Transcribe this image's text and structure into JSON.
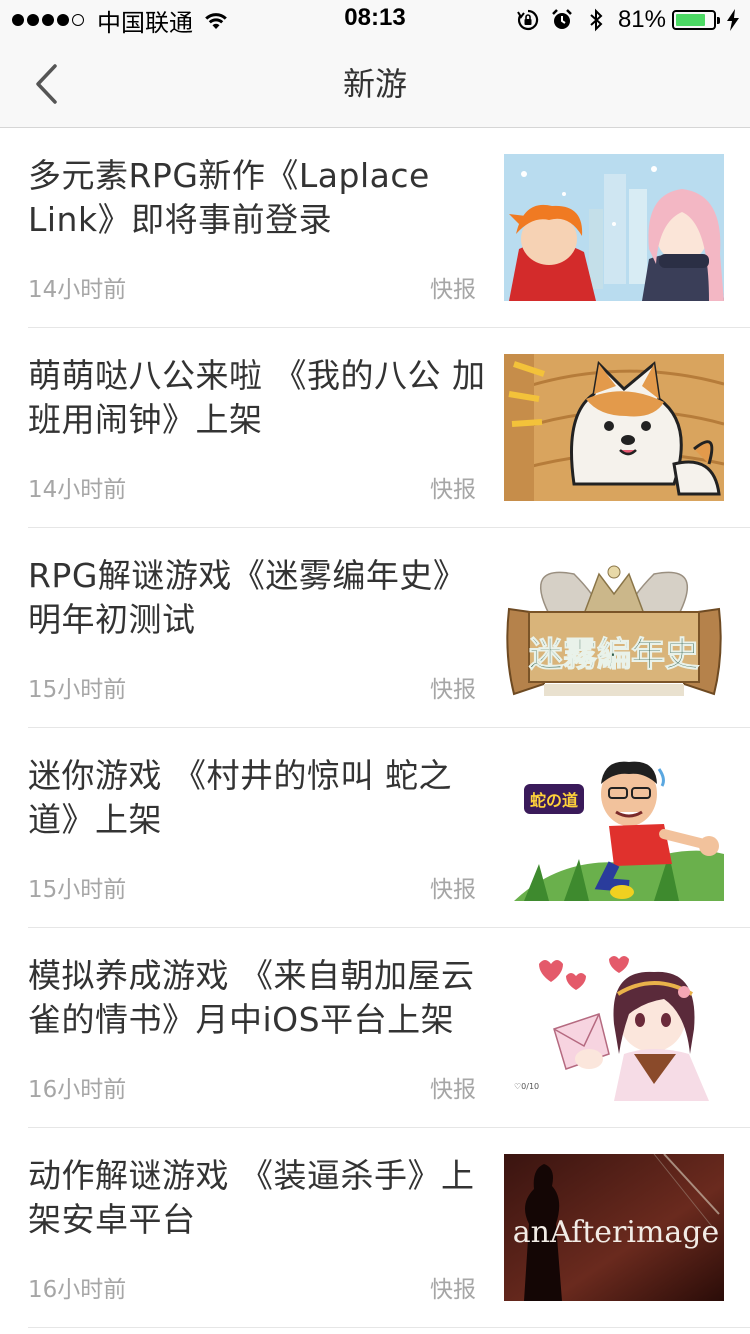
{
  "status_bar": {
    "carrier": "中国联通",
    "time": "08:13",
    "battery_percent_label": "81%",
    "battery_level": 0.81
  },
  "nav": {
    "title": "新游",
    "back_icon": "chevron-left-icon"
  },
  "articles": [
    {
      "title": "多元素RPG新作《Laplace Link》即将事前登录",
      "time": "14小时前",
      "tag": "快报",
      "thumb_icon": "anime-winter-characters-image"
    },
    {
      "title": "萌萌哒八公来啦 《我的八公 加班用闹钟》上架",
      "time": "14小时前",
      "tag": "快报",
      "thumb_icon": "shiba-dog-image"
    },
    {
      "title": "RPG解谜游戏《迷雾编年史》明年初测试",
      "time": "15小时前",
      "tag": "快报",
      "thumb_icon": "chronicle-logo-image"
    },
    {
      "title": "迷你游戏 《村井的惊叫 蛇之道》上架",
      "time": "15小时前",
      "tag": "快报",
      "thumb_icon": "running-man-image"
    },
    {
      "title": "模拟养成游戏 《来自朝加屋云雀的情书》月中iOS平台上架",
      "time": "16小时前",
      "tag": "快报",
      "thumb_icon": "girl-love-letter-image"
    },
    {
      "title": "动作解谜游戏 《装逼杀手》上架安卓平台",
      "time": "16小时前",
      "tag": "快报",
      "thumb_icon": "afterimage-title-image"
    }
  ],
  "thumb_text": {
    "chronicle_logo": "迷霧編年史",
    "afterimage_logo": "anAfterimage",
    "snake_logo": "蛇の道"
  }
}
